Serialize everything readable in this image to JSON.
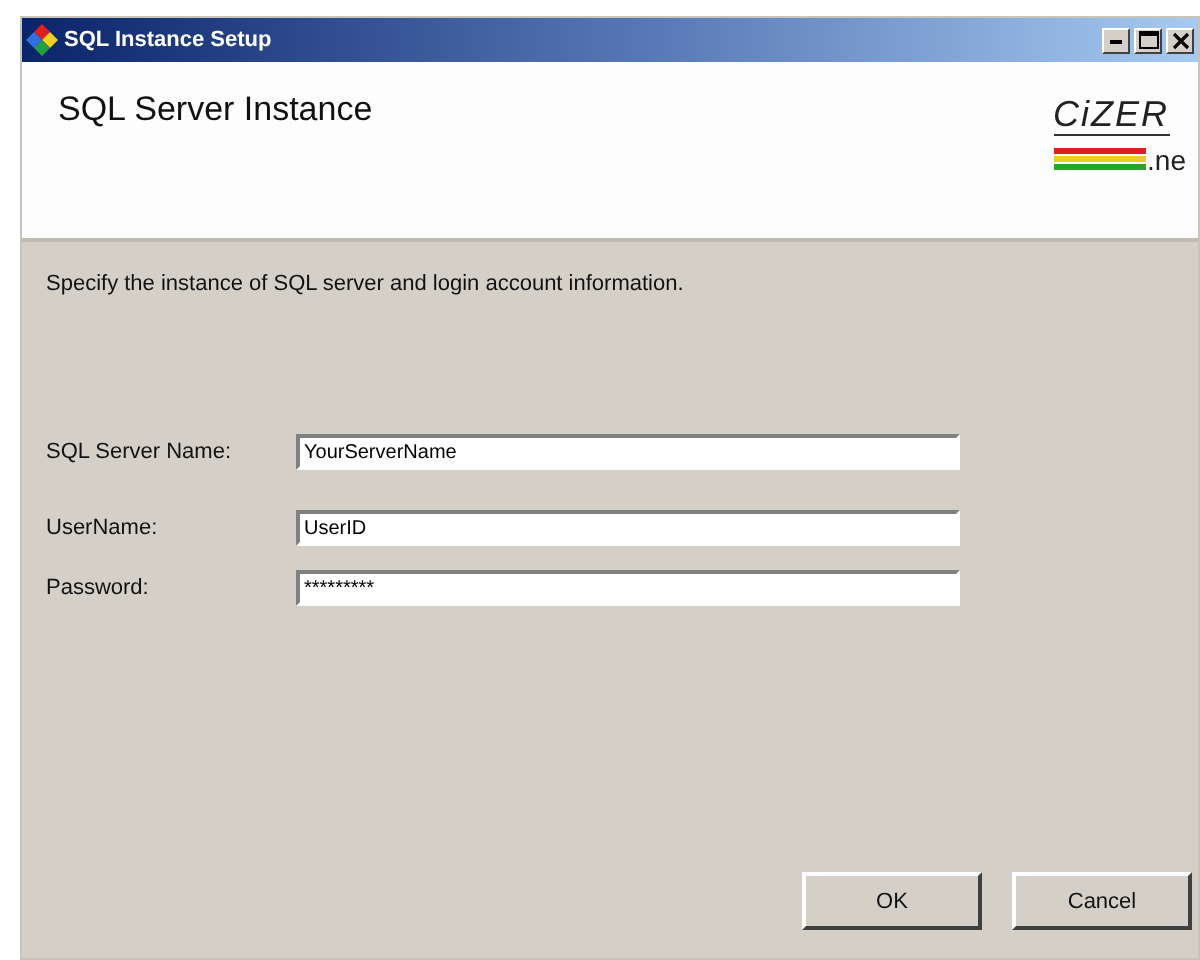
{
  "window": {
    "title": "SQL Instance Setup"
  },
  "header": {
    "title": "SQL Server Instance",
    "logo": {
      "top": "CiZER",
      "bottom": ".ne"
    }
  },
  "instruction": "Specify the instance of SQL server and login account information.",
  "fields": [
    {
      "label": "SQL Server Name:",
      "value": "YourServerName"
    },
    {
      "label": "UserName:",
      "value": "UserID"
    },
    {
      "label": "Password:",
      "value": "*********"
    }
  ],
  "buttons": [
    "OK",
    "Cancel"
  ]
}
